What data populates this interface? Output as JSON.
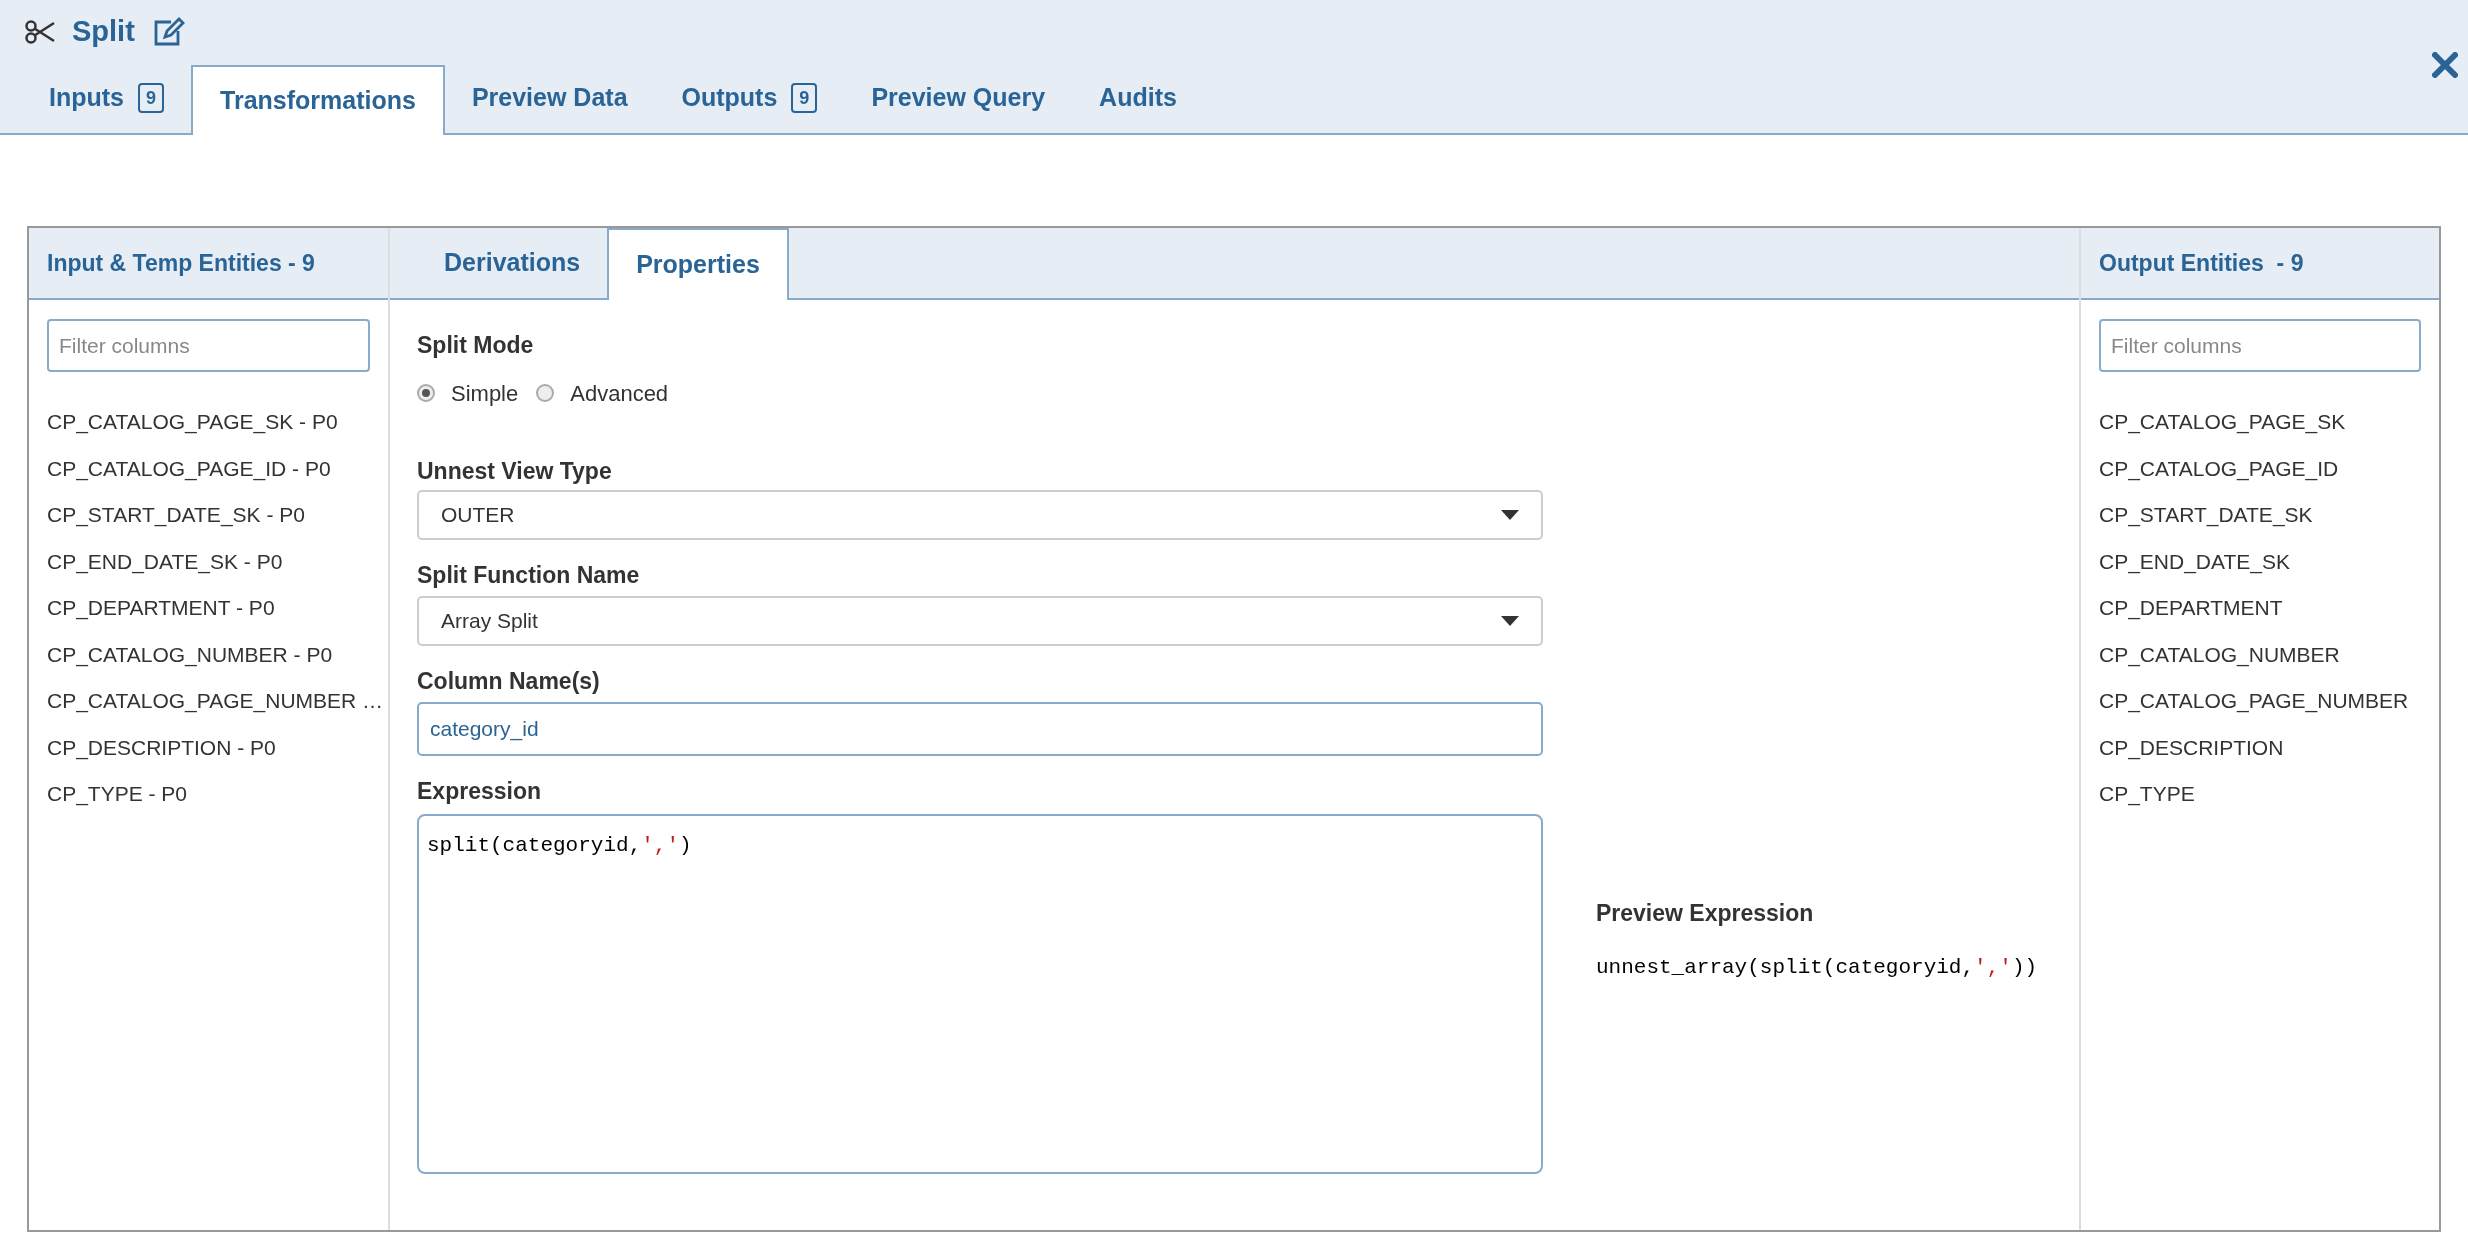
{
  "header": {
    "title": "Split"
  },
  "tabs": [
    {
      "label": "Inputs",
      "badge": "9",
      "selected": false
    },
    {
      "label": "Transformations",
      "selected": true
    },
    {
      "label": "Preview Data",
      "selected": false
    },
    {
      "label": "Outputs",
      "badge": "9",
      "selected": false
    },
    {
      "label": "Preview Query",
      "selected": false
    },
    {
      "label": "Audits",
      "selected": false
    }
  ],
  "input_panel": {
    "title": "Input & Temp Entities - 9",
    "filter": {
      "placeholder": "Filter columns"
    },
    "items": [
      "CP_CATALOG_PAGE_SK - P0",
      "CP_CATALOG_PAGE_ID - P0",
      "CP_START_DATE_SK - P0",
      "CP_END_DATE_SK - P0",
      "CP_DEPARTMENT - P0",
      "CP_CATALOG_NUMBER - P0",
      "CP_CATALOG_PAGE_NUMBER …",
      "CP_DESCRIPTION - P0",
      "CP_TYPE - P0"
    ]
  },
  "center_tabs": [
    {
      "label": "Derivations",
      "selected": false
    },
    {
      "label": "Properties",
      "selected": true
    }
  ],
  "properties": {
    "split_mode": {
      "label": "Split Mode",
      "options": [
        {
          "label": "Simple",
          "selected": true
        },
        {
          "label": "Advanced",
          "selected": false
        }
      ]
    },
    "unnest_view_type": {
      "label": "Unnest View Type",
      "value": "OUTER"
    },
    "split_function_name": {
      "label": "Split Function Name",
      "value": "Array Split"
    },
    "column_names": {
      "label": "Column Name(s)",
      "value": "category_id"
    },
    "expression": {
      "label": "Expression",
      "tokens": [
        {
          "text": "split(categoryid,",
          "kind": "plain"
        },
        {
          "text": "','",
          "kind": "string"
        },
        {
          "text": ")",
          "kind": "plain"
        }
      ]
    },
    "preview_expression": {
      "label": "Preview Expression",
      "tokens": [
        {
          "text": "unnest_array(split(categoryid,",
          "kind": "plain"
        },
        {
          "text": "','",
          "kind": "string"
        },
        {
          "text": "))",
          "kind": "plain"
        }
      ]
    }
  },
  "output_panel": {
    "title": "Output Entities  - 9",
    "filter": {
      "placeholder": "Filter columns"
    },
    "items": [
      "CP_CATALOG_PAGE_SK",
      "CP_CATALOG_PAGE_ID",
      "CP_START_DATE_SK",
      "CP_END_DATE_SK",
      "CP_DEPARTMENT",
      "CP_CATALOG_NUMBER",
      "CP_CATALOG_PAGE_NUMBER",
      "CP_DESCRIPTION",
      "CP_TYPE"
    ]
  }
}
